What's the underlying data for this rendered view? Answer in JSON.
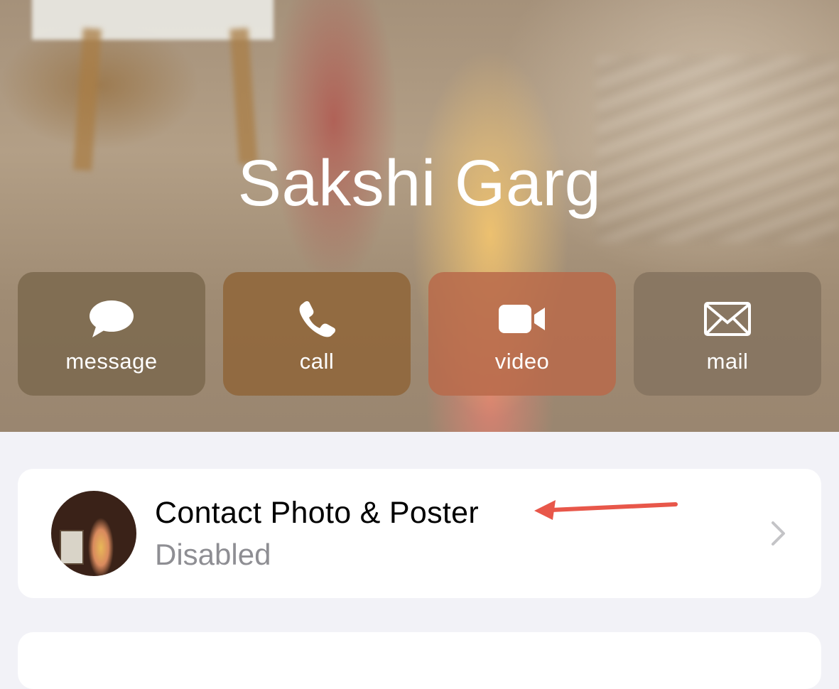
{
  "contact": {
    "name": "Sakshi Garg"
  },
  "actions": [
    {
      "label": "message",
      "icon": "message-bubble-icon",
      "bg": "#7b684e"
    },
    {
      "label": "call",
      "icon": "phone-icon",
      "bg": "#8f6538"
    },
    {
      "label": "video",
      "icon": "video-camera-icon",
      "bg": "#b86a4a"
    },
    {
      "label": "mail",
      "icon": "envelope-icon",
      "bg": "#85735f"
    }
  ],
  "poster_row": {
    "title": "Contact Photo & Poster",
    "status": "Disabled",
    "chevron": "chevron-right-icon"
  },
  "annotation": {
    "color": "#e8574a",
    "icon": "arrow-left-icon"
  }
}
